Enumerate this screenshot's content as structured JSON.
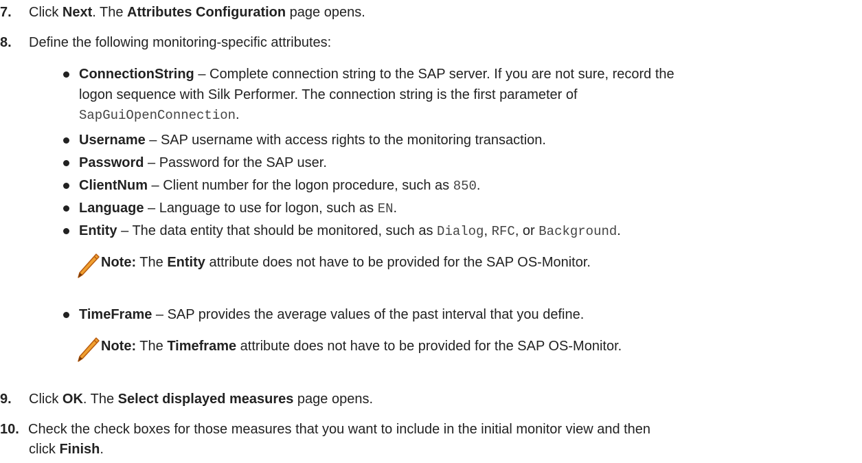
{
  "steps": [
    {
      "num": "7.",
      "parts": [
        "Click ",
        "Next",
        ". The ",
        "Attributes Configuration",
        " page opens."
      ]
    },
    {
      "num": "8.",
      "text": "Define the following monitoring-specific attributes:"
    },
    {
      "num": "9.",
      "parts": [
        "Click ",
        "OK",
        ". The ",
        "Select displayed measures",
        " page opens."
      ]
    },
    {
      "num": "10.",
      "line1": "Check the check boxes for those measures that you want to include in the initial monitor view and then",
      "line2_pre": "click ",
      "line2_bold": "Finish",
      "line2_post": "."
    }
  ],
  "attributes": {
    "connection": {
      "name": "ConnectionString",
      "line1": " – Complete connection string to the SAP server. If you are not sure, record the",
      "line2": "logon sequence with Silk Performer. The connection string is the first parameter of",
      "code": "SapGuiOpenConnection",
      "end": "."
    },
    "username": {
      "name": "Username",
      "desc": " – SAP username with access rights to the monitoring transaction."
    },
    "password": {
      "name": "Password",
      "desc": " – Password for the SAP user."
    },
    "clientnum": {
      "name": "ClientNum",
      "desc": " – Client number for the logon procedure, such as ",
      "code": "850",
      "end": "."
    },
    "language": {
      "name": "Language",
      "desc": " – Language to use for logon, such as ",
      "code": "EN",
      "end": "."
    },
    "entity": {
      "name": "Entity",
      "desc": " – The data entity that should be monitored, such as ",
      "code1": "Dialog",
      "sep1": ", ",
      "code2": "RFC",
      "sep2": ", or ",
      "code3": "Background",
      "end": "."
    },
    "timeframe": {
      "name": "TimeFrame",
      "desc": " – SAP provides the average values of the past interval that you define."
    }
  },
  "notes": [
    {
      "label": "Note:",
      "pre": " The ",
      "bold": "Entity",
      "post": " attribute does not have to be provided for the SAP OS-Monitor."
    },
    {
      "label": "Note:",
      "pre": " The ",
      "bold": "Timeframe",
      "post": " attribute does not have to be provided for the SAP OS-Monitor."
    }
  ],
  "icons": {
    "note": "pencil-icon"
  },
  "colors": {
    "text": "#222222",
    "code": "#444444",
    "pencil_fill": "#f0a030",
    "pencil_edge": "#b85c10"
  }
}
